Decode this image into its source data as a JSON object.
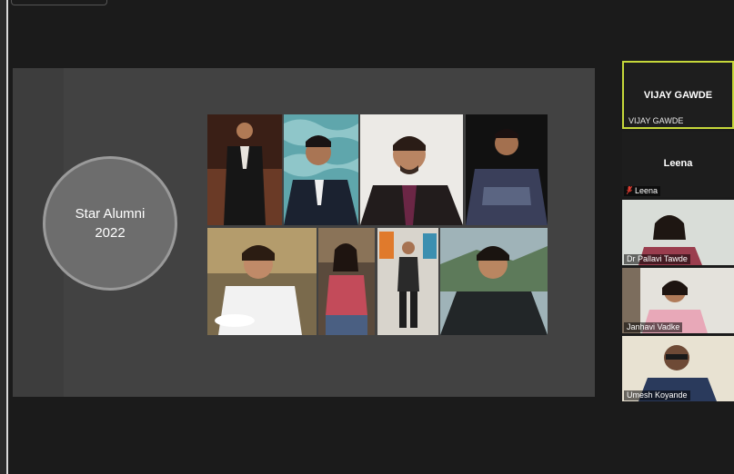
{
  "slide": {
    "title_line1": "Star Alumni",
    "title_line2": "2022"
  },
  "participants": {
    "active_speaker": {
      "center_name": "VIJAY GAWDE",
      "label": "VIJAY GAWDE"
    },
    "leena": {
      "center_name": "Leena",
      "label": "Leena",
      "muted": true
    },
    "pallavi": {
      "label": "Dr Pallavi Tawde"
    },
    "janhavi": {
      "label": "Janhavi Vadke"
    },
    "umesh": {
      "label": "Umesh Koyande"
    }
  },
  "colors": {
    "background": "#1b1b1b",
    "active_speaker_border": "#c6d83a",
    "muted_mic": "#e03c31"
  }
}
